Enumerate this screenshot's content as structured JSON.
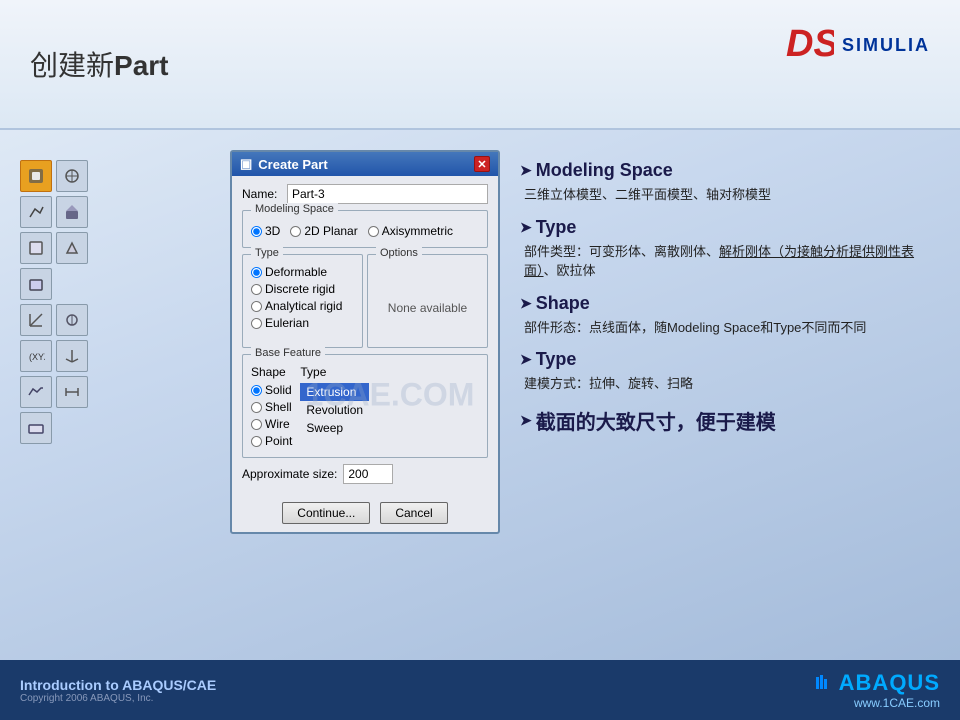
{
  "header": {
    "title_pre": "创建新",
    "title_bold": "Part"
  },
  "dialog": {
    "title": "Create Part",
    "name_label": "Name:",
    "name_value": "Part-3",
    "modeling_space_label": "Modeling Space",
    "radio_3d": "3D",
    "radio_2d": "2D Planar",
    "radio_axisymmetric": "Axisymmetric",
    "type_label": "Type",
    "options_label": "Options",
    "type_deformable": "Deformable",
    "type_discrete": "Discrete rigid",
    "type_analytical": "Analytical rigid",
    "type_eulerian": "Eulerian",
    "none_available": "None available",
    "base_feature_label": "Base Feature",
    "shape_label": "Shape",
    "shape_solid": "Solid",
    "shape_shell": "Shell",
    "shape_wire": "Wire",
    "shape_point": "Point",
    "type2_label": "Type",
    "type2_extrusion": "Extrusion",
    "type2_revolution": "Revolution",
    "type2_sweep": "Sweep",
    "approx_label": "Approximate size:",
    "approx_value": "200",
    "btn_continue": "Continue...",
    "btn_cancel": "Cancel"
  },
  "right": {
    "section1_heading": "Modeling Space",
    "section1_text": "三维立体模型、二维平面模型、轴对称模型",
    "section2_heading": "Type",
    "section2_text_part1": "部件类型：可变形体、离散刚体、",
    "section2_link": "解析刚体（为接触分析提供刚性表面）",
    "section2_text_part2": "、欧拉体",
    "section3_heading": "Shape",
    "section3_text": "部件形态：点线面体，随Modeling Space和Type不同而不同",
    "section4_heading": "Type",
    "section4_text": "建模方式：拉伸、旋转、扫略",
    "section5_heading": "截面的大致尺寸，便于建模"
  },
  "bottom": {
    "title": "Introduction to ABAQUS/CAE",
    "copyright": "Copyright 2006 ABAQUS, Inc.",
    "logo": "ABAQUS",
    "url": "www.1CAE.com"
  },
  "simulia": {
    "ds": "DS",
    "name": "SIMULIA"
  },
  "watermark": "1CAE.COM"
}
